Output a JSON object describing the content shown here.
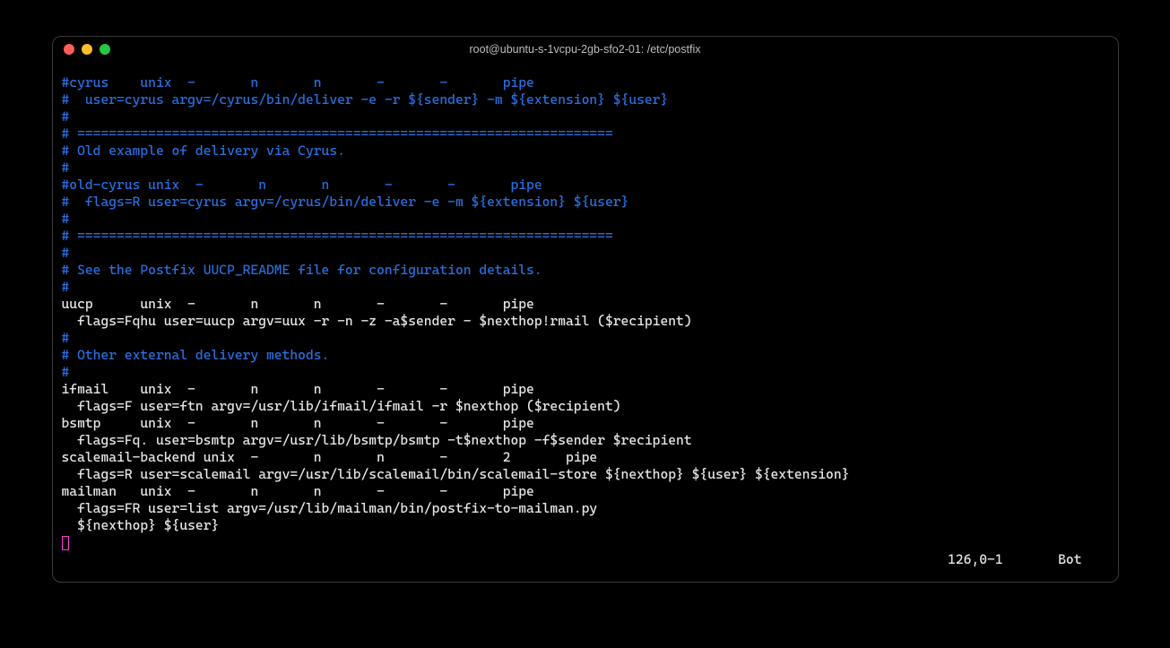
{
  "window": {
    "title": "root@ubuntu-s-1vcpu-2gb-sfo2-01: /etc/postfix"
  },
  "traffic_lights": {
    "close": "close",
    "minimize": "minimize",
    "zoom": "zoom"
  },
  "lines": [
    {
      "cls": "c-blue",
      "text": "#cyrus    unix  -       n       n       -       -       pipe"
    },
    {
      "cls": "c-blue",
      "text": "#  user=cyrus argv=/cyrus/bin/deliver -e -r ${sender} -m ${extension} ${user}"
    },
    {
      "cls": "c-blue",
      "text": "#"
    },
    {
      "cls": "c-blue",
      "text": "# ===================================================================="
    },
    {
      "cls": "c-blue",
      "text": "# Old example of delivery via Cyrus."
    },
    {
      "cls": "c-blue",
      "text": "#"
    },
    {
      "cls": "c-blue",
      "text": "#old-cyrus unix  -       n       n       -       -       pipe"
    },
    {
      "cls": "c-blue",
      "text": "#  flags=R user=cyrus argv=/cyrus/bin/deliver -e -m ${extension} ${user}"
    },
    {
      "cls": "c-blue",
      "text": "#"
    },
    {
      "cls": "c-blue",
      "text": "# ===================================================================="
    },
    {
      "cls": "c-blue",
      "text": "#"
    },
    {
      "cls": "c-blue",
      "text": "# See the Postfix UUCP_README file for configuration details."
    },
    {
      "cls": "c-blue",
      "text": "#"
    },
    {
      "cls": "c-white",
      "text": "uucp      unix  -       n       n       -       -       pipe"
    },
    {
      "cls": "c-white",
      "text": "  flags=Fqhu user=uucp argv=uux -r -n -z -a$sender - $nexthop!rmail ($recipient)"
    },
    {
      "cls": "c-blue",
      "text": "#"
    },
    {
      "cls": "c-blue",
      "text": "# Other external delivery methods."
    },
    {
      "cls": "c-blue",
      "text": "#"
    },
    {
      "cls": "c-white",
      "text": "ifmail    unix  -       n       n       -       -       pipe"
    },
    {
      "cls": "c-white",
      "text": "  flags=F user=ftn argv=/usr/lib/ifmail/ifmail -r $nexthop ($recipient)"
    },
    {
      "cls": "c-white",
      "text": "bsmtp     unix  -       n       n       -       -       pipe"
    },
    {
      "cls": "c-white",
      "text": "  flags=Fq. user=bsmtp argv=/usr/lib/bsmtp/bsmtp -t$nexthop -f$sender $recipient"
    },
    {
      "cls": "c-white",
      "text": "scalemail-backend unix  -       n       n       -       2       pipe"
    },
    {
      "cls": "c-white",
      "text": "  flags=R user=scalemail argv=/usr/lib/scalemail/bin/scalemail-store ${nexthop} ${user} ${extension}"
    },
    {
      "cls": "c-white",
      "text": "mailman   unix  -       n       n       -       -       pipe"
    },
    {
      "cls": "c-white",
      "text": "  flags=FR user=list argv=/usr/lib/mailman/bin/postfix-to-mailman.py"
    },
    {
      "cls": "c-white",
      "text": "  ${nexthop} ${user}"
    }
  ],
  "status": {
    "position": "126,0-1",
    "location": "Bot"
  },
  "status_combined": "126,0-1       Bot"
}
